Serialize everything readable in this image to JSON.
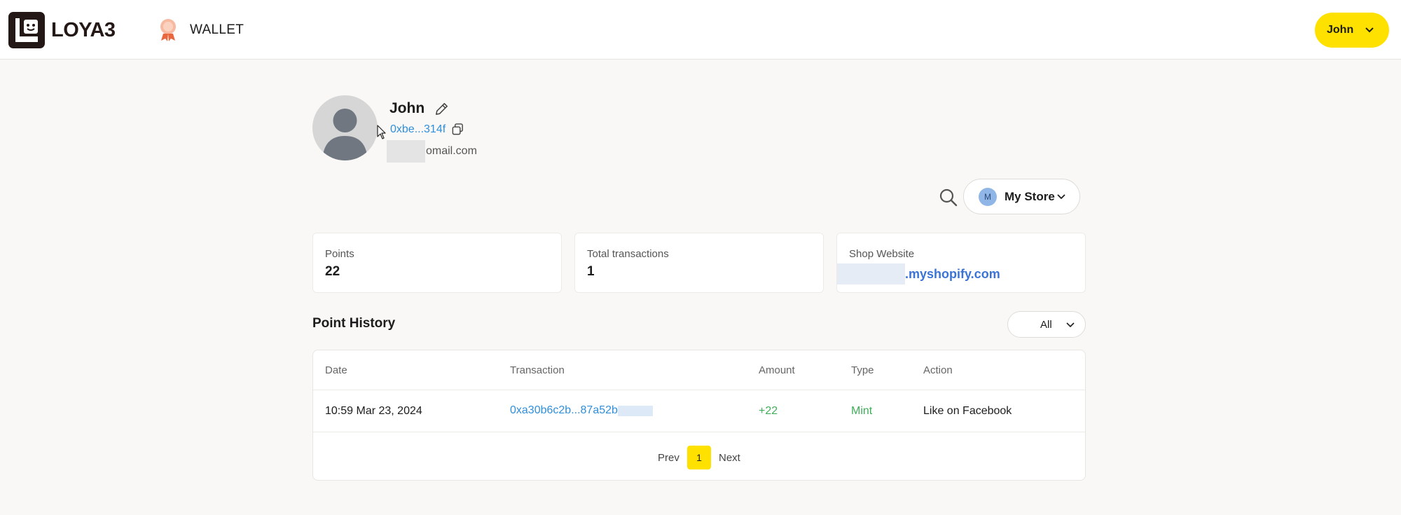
{
  "header": {
    "brand": "LOYA3",
    "nav_wallet": "WALLET",
    "user_menu": "John"
  },
  "profile": {
    "name": "John",
    "address": "0xbe...314f",
    "email": "omail.com"
  },
  "controls": {
    "store_badge": "M",
    "store_label": "My Store"
  },
  "stats": {
    "points_label": "Points",
    "points_value": "22",
    "transactions_label": "Total transactions",
    "transactions_value": "1",
    "website_label": "Shop Website",
    "website_value": ".myshopify.com"
  },
  "history": {
    "title": "Point History",
    "filter": "All",
    "columns": [
      "Date",
      "Transaction",
      "Amount",
      "Type",
      "Action"
    ],
    "rows": [
      {
        "date": "10:59 Mar 23, 2024",
        "transaction": "0xa30b6c2b...87a52b",
        "amount": "+22",
        "type": "Mint",
        "action": "Like on Facebook"
      }
    ],
    "pager": {
      "prev": "Prev",
      "current": "1",
      "next": "Next"
    }
  },
  "colors": {
    "accent": "#ffe100",
    "link": "#2f8fdb",
    "positive": "#3fae58",
    "background": "#f9f8f6"
  }
}
